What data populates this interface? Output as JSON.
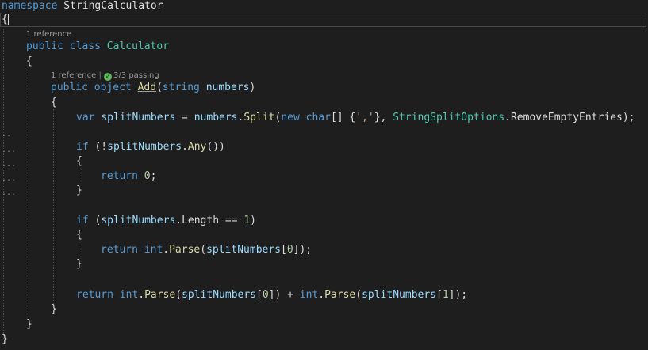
{
  "code": {
    "kw_namespace": "namespace",
    "ns_name": "StringCalculator",
    "brace_open": "{",
    "brace_close": "}",
    "kw_public": "public",
    "kw_class": "class",
    "class_name": "Calculator",
    "kw_object": "object",
    "method_add": "Add",
    "paren_open": "(",
    "paren_close": ")",
    "kw_string": "string",
    "param_numbers": "numbers",
    "kw_var": "var",
    "var_split": "splitNumbers",
    "op_assign": " = ",
    "dot": ".",
    "method_split": "Split",
    "kw_new": "new",
    "kw_char": "char",
    "array_brackets": "[] {",
    "char_literal": "','",
    "array_close": "}, ",
    "type_options": "StringSplitOptions",
    "enum_remove": "RemoveEmptyEntries",
    "stmt_end": ");",
    "kw_if": "if",
    "if_open_not": " (!",
    "method_any": "Any",
    "call_close": "())",
    "kw_return": "return",
    "num_zero": "0",
    "semicolon": ";",
    "if_open": " (",
    "prop_length": "Length",
    "op_eq": " == ",
    "num_one": "1",
    "kw_int": "int",
    "method_parse": "Parse",
    "index_zero": "[0]",
    "index_one": "[1]",
    "idx_open": "[",
    "idx_close": "]",
    "plus": " + ",
    "close_paren_semi": ");",
    "close_paren": ")"
  },
  "codelens": {
    "class_refs": "1 reference",
    "method_refs": "1 reference",
    "separator": "|",
    "tests_passing": "3/3 passing"
  },
  "icons": {
    "test_pass": "check-circle-icon"
  },
  "colors": {
    "background": "#1e1e1e",
    "keyword": "#569cd6",
    "type": "#4ec9b0",
    "method": "#dcdcaa",
    "string": "#d69d85",
    "number": "#b5cea8",
    "variable": "#9cdcfe",
    "pass": "#5fb760"
  }
}
